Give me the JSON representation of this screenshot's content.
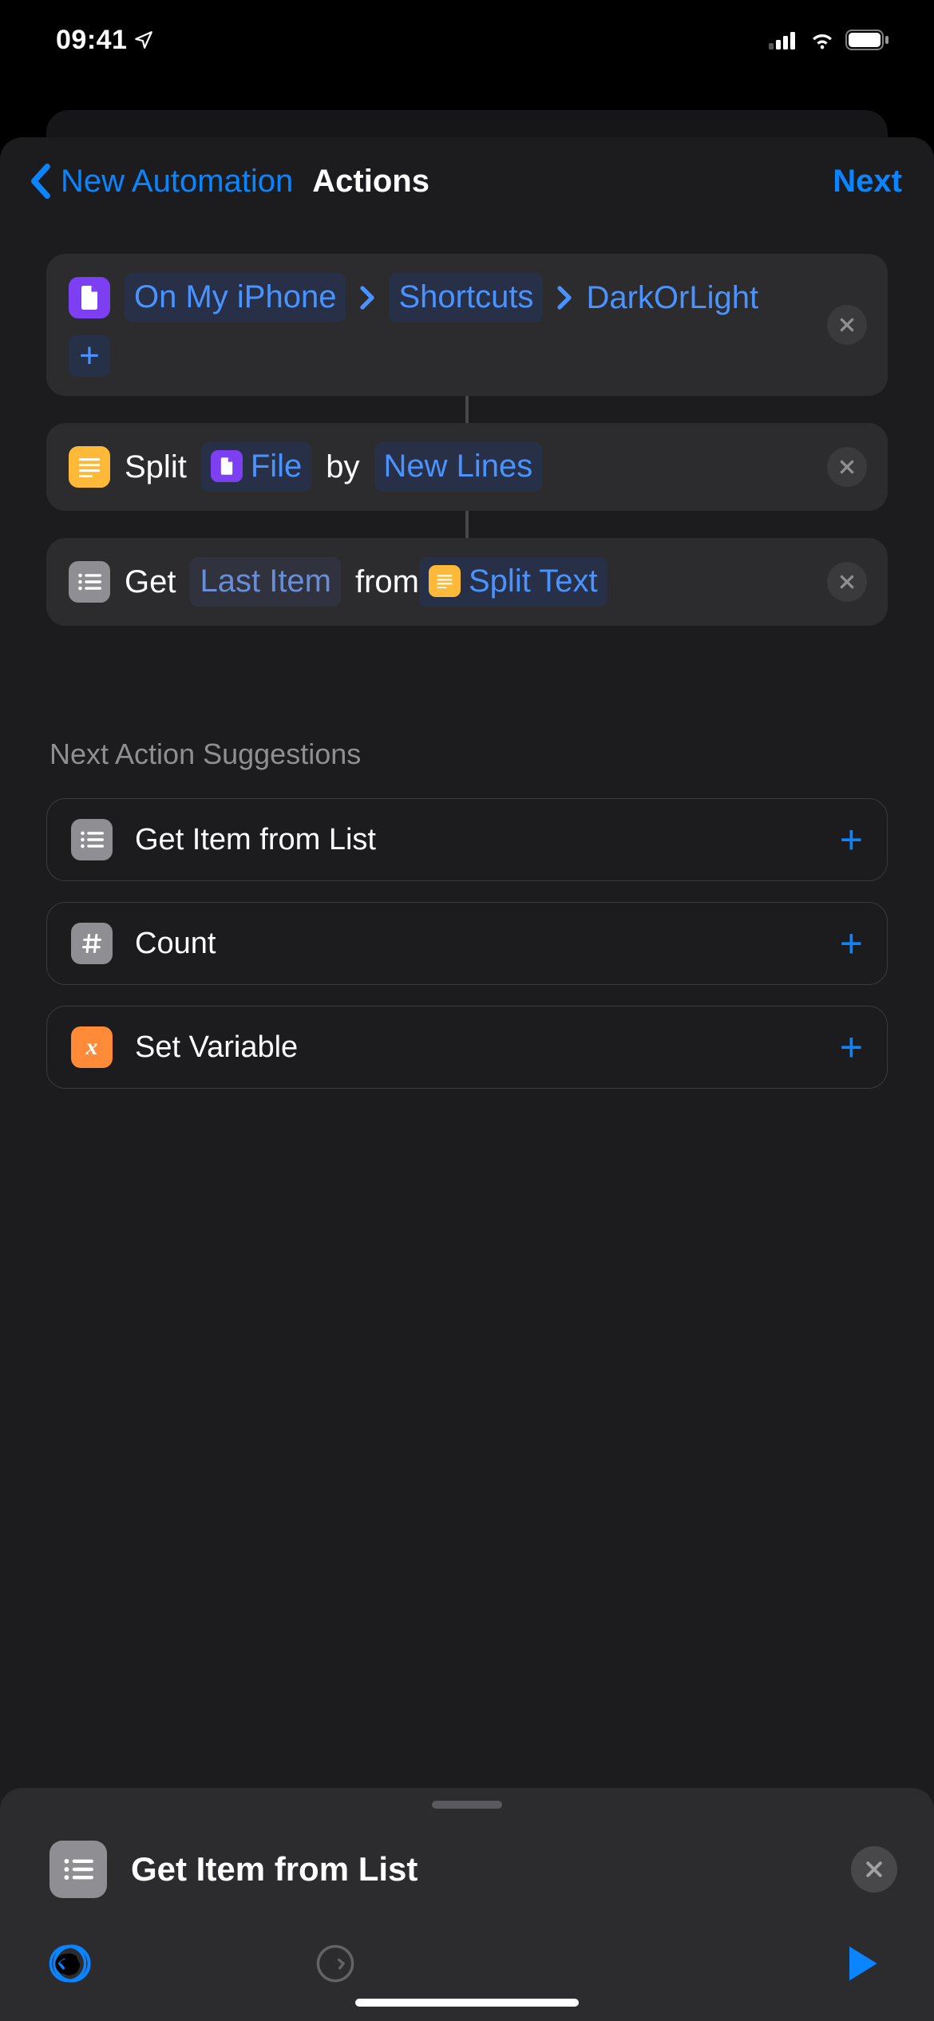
{
  "status": {
    "time": "09:41"
  },
  "nav": {
    "back": "New Automation",
    "title": "Actions",
    "next": "Next"
  },
  "actions": [
    {
      "kind": "path",
      "icon": "file-icon",
      "iconColor": "purple",
      "segments": [
        "On My iPhone",
        "Shortcuts"
      ],
      "tail": "DarkOrLight"
    },
    {
      "kind": "split",
      "icon": "text-lines-icon",
      "iconColor": "yellow",
      "verb": "Split",
      "param1Label": "File",
      "joiner": "by",
      "param2Label": "New Lines"
    },
    {
      "kind": "get",
      "icon": "list-icon",
      "iconColor": "gray",
      "verb": "Get",
      "selector": "Last Item",
      "joiner": "from",
      "sourceIcon": "text-lines-icon",
      "sourceLabel": "Split Text"
    }
  ],
  "suggestionsTitle": "Next Action Suggestions",
  "suggestions": [
    {
      "icon": "list-icon",
      "iconColor": "gray",
      "label": "Get Item from List"
    },
    {
      "icon": "hash-icon",
      "iconColor": "gray",
      "label": "Count"
    },
    {
      "icon": "var-icon",
      "iconColor": "orange",
      "label": "Set Variable"
    }
  ],
  "search": {
    "value": "Get Item from List"
  }
}
